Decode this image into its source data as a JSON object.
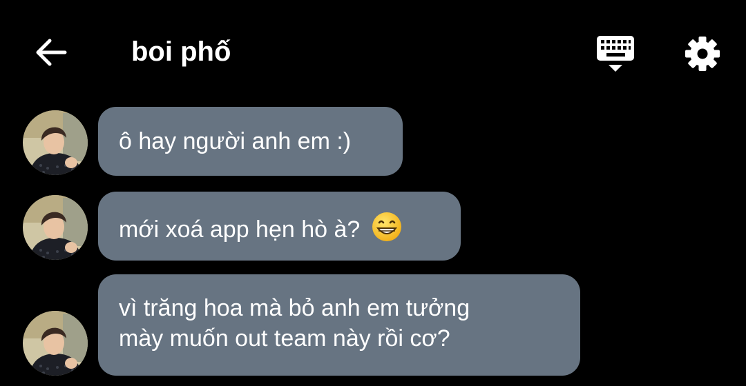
{
  "header": {
    "title": "boi phố",
    "back_icon": "arrow-left-icon",
    "keyboard_icon": "keyboard-icon",
    "settings_icon": "gear-icon"
  },
  "messages": [
    {
      "text": "ô hay người anh em :)"
    },
    {
      "text": "mới xoá app hẹn hò à?",
      "emoji": "grinning-face-emoji"
    },
    {
      "line1": "vì trăng hoa mà bỏ anh em tưởng",
      "line2": "mày muốn out team này rồi cơ?"
    }
  ],
  "colors": {
    "background": "#000000",
    "bubble": "#677482",
    "text": "#ffffff"
  }
}
